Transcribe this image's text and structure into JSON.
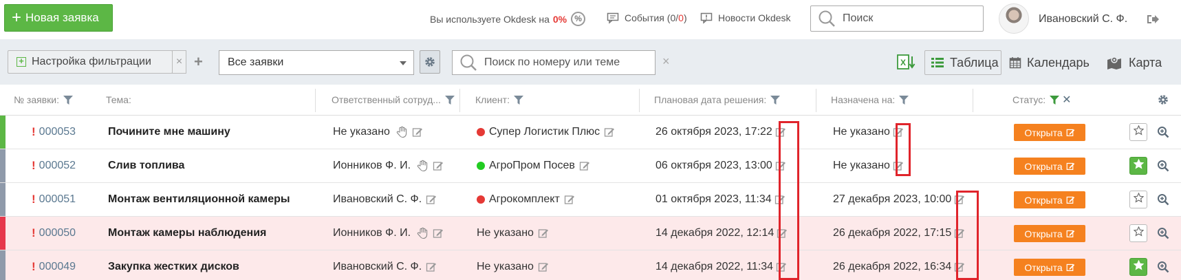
{
  "header": {
    "new_request_label": "Новая заявка",
    "usage_text": "Вы используете Okdesk на",
    "usage_percent": "0%",
    "usage_help": "%",
    "events_label": "События",
    "events_open": "(0/",
    "events_new": "0",
    "events_close": ")",
    "news_label": "Новости Okdesk",
    "search_placeholder": "Поиск",
    "user_name": "Ивановский С. Ф."
  },
  "toolbar": {
    "filter_settings_label": "Настройка фильтрации",
    "clear_label": "×",
    "add_label": "+",
    "view_select_value": "Все заявки",
    "search_placeholder": "Поиск по номеру или теме",
    "search_clear": "×",
    "table_label": "Таблица",
    "calendar_label": "Календарь",
    "map_label": "Карта"
  },
  "columns": {
    "number": "№ заявки:",
    "topic": "Тема:",
    "responsible": "Ответственный сотруд...",
    "client": "Клиент:",
    "planned_date": "Плановая дата решения:",
    "assigned_to": "Назначена на:",
    "status": "Статус:"
  },
  "colors": {
    "green": "#5cb745",
    "orange": "#f5811f",
    "red": "#e53935",
    "highlight": "#e0242b",
    "stripe_green": "#5cb745",
    "stripe_gray": "#8f9aaa",
    "stripe_red": "#e6384c"
  },
  "rows": [
    {
      "num": "000053",
      "topic": "Почините мне машину",
      "responsible": "Не указано",
      "resp_hand": true,
      "client": "Супер Логистик Плюс",
      "client_dot": "#e53935",
      "planned": "26 октября 2023, 17:22",
      "assigned": "Не указано",
      "status": "Открыта",
      "starred": false,
      "bg": "white",
      "stripe": "green"
    },
    {
      "num": "000052",
      "topic": "Слив топлива",
      "responsible": "Ионников Ф. И.",
      "resp_hand": true,
      "client": "АгроПром Посев",
      "client_dot": "#22cc22",
      "planned": "06 октября 2023, 13:00",
      "assigned": "Не указано",
      "status": "Открыта",
      "starred": true,
      "bg": "white",
      "stripe": "gray"
    },
    {
      "num": "000051",
      "topic": "Монтаж вентиляционной камеры",
      "responsible": "Ивановский С. Ф.",
      "resp_hand": false,
      "client": "Агрокомплект",
      "client_dot": "#e53935",
      "planned": "01 октября 2023, 11:34",
      "assigned": "27 декабря 2023, 10:00",
      "status": "Открыта",
      "starred": false,
      "bg": "white",
      "stripe": "gray"
    },
    {
      "num": "000050",
      "topic": "Монтаж камеры наблюдения",
      "responsible": "Ионников Ф. И.",
      "resp_hand": true,
      "client": "Не указано",
      "client_dot": "",
      "planned": "14 декабря 2022, 12:14",
      "assigned": "26 декабря 2022, 17:15",
      "status": "Открыта",
      "starred": false,
      "bg": "pink",
      "stripe": "red"
    },
    {
      "num": "000049",
      "topic": "Закупка жестких дисков",
      "responsible": "Ивановский С. Ф.",
      "resp_hand": false,
      "client": "Не указано",
      "client_dot": "",
      "planned": "14 декабря 2022, 11:34",
      "assigned": "26 декабря 2022, 16:34",
      "status": "Открыта",
      "starred": true,
      "bg": "pink",
      "stripe": "gray"
    }
  ]
}
